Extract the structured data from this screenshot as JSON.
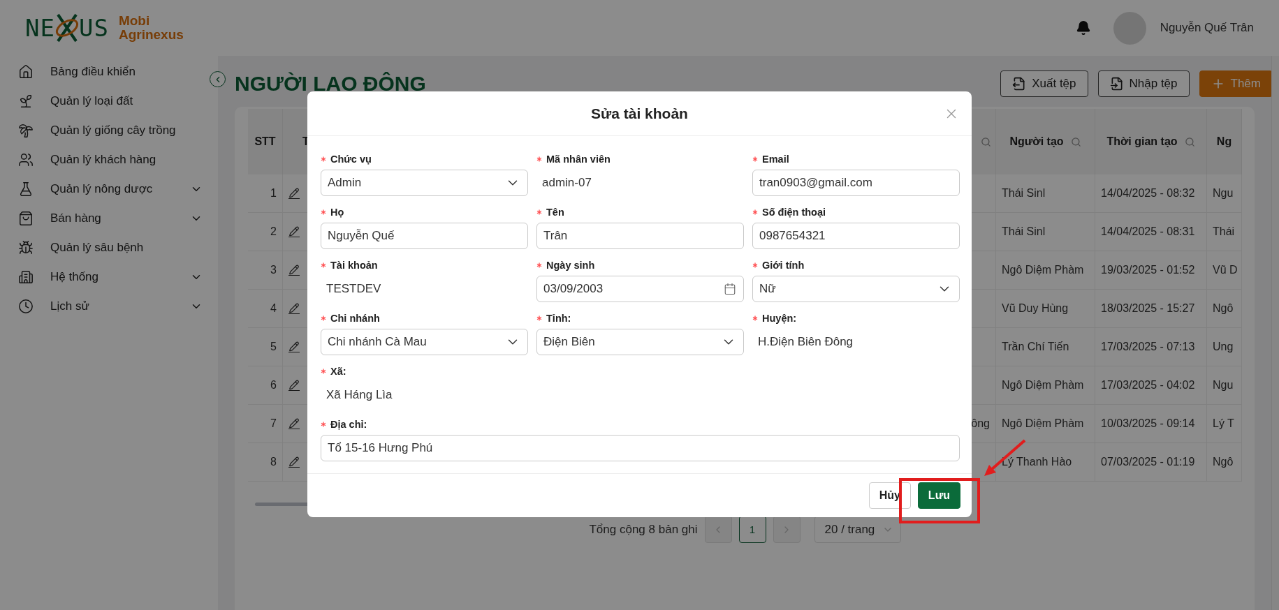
{
  "header": {
    "logo": {
      "left": "NE",
      "right": "US",
      "name_line_1": "Mobi",
      "name_line_2": "Agrinexus"
    },
    "user_name": "Nguyễn Quế Trân"
  },
  "sidebar": {
    "items": [
      {
        "label": "Bảng điều khiển",
        "expandable": false
      },
      {
        "label": "Quản lý loại đất",
        "expandable": false
      },
      {
        "label": "Quản lý giống cây trồng",
        "expandable": false
      },
      {
        "label": "Quản lý khách hàng",
        "expandable": false
      },
      {
        "label": "Quản lý nông dược",
        "expandable": true
      },
      {
        "label": "Bán hàng",
        "expandable": true
      },
      {
        "label": "Quản lý sâu bệnh",
        "expandable": false
      },
      {
        "label": "Hệ thống",
        "expandable": true
      },
      {
        "label": "Lịch sử",
        "expandable": true
      }
    ]
  },
  "page": {
    "title": "NGƯỜI LAO ĐỘNG",
    "actions": [
      {
        "label": "Xuất tệp",
        "kind": "export"
      },
      {
        "label": "Nhập tệp",
        "kind": "import"
      },
      {
        "label": "Thêm",
        "kind": "add"
      }
    ]
  },
  "table": {
    "columns": [
      {
        "label": "STT"
      },
      {
        "label": "T"
      },
      {
        "searchable": true
      },
      {
        "label": "Người tạo",
        "searchable": true
      },
      {
        "label": "Thời gian tạo",
        "searchable": true
      },
      {
        "label": "Ng"
      }
    ],
    "rows": [
      {
        "stt": "1",
        "nguoi_tao": "Thái Sinl",
        "thoi_gian_tao": "14/04/2025 - 08:32",
        "column_6": "Ngu"
      },
      {
        "stt": "2",
        "nguoi_tao": "Thái Sinl",
        "thoi_gian_tao": "14/04/2025 - 08:31",
        "column_6": "Thái"
      },
      {
        "stt": "3",
        "nguoi_tao": "Ngô Diệm Phàm",
        "thoi_gian_tao": "19/03/2025 - 01:52",
        "column_6": "Vũ D"
      },
      {
        "stt": "4",
        "nguoi_tao": "Vũ Duy Hùng",
        "thoi_gian_tao": "18/03/2025 - 15:27",
        "column_6": "Ngô"
      },
      {
        "stt": "5",
        "nguoi_tao": "Trần Chí Tiến",
        "thoi_gian_tao": "17/03/2025 - 07:13",
        "column_6": "Ung"
      },
      {
        "stt": "6",
        "nguoi_tao": "Ngô Diệm Phàm",
        "thoi_gian_tao": "17/03/2025 - 04:02",
        "column_6": "Ngu"
      },
      {
        "stt": "7",
        "column_3": "ông",
        "nguoi_tao": "Ngô Diệm Phàm",
        "thoi_gian_tao": "10/03/2025 - 09:14",
        "column_6": "Lý T"
      },
      {
        "stt": "8",
        "nguoi_tao": "Lý Thanh Hào",
        "thoi_gian_tao": "07/03/2025 - 01:19",
        "column_6": "Ngô"
      }
    ]
  },
  "pagination": {
    "total": "Tổng cộng 8 bản ghi",
    "pages": [
      {
        "label": "1",
        "selected": true
      }
    ],
    "page_size": "20 / trang"
  },
  "modal": {
    "title": "Sửa tài khoản",
    "fields": [
      {
        "label": "Chức vụ",
        "required": true,
        "kind": "select",
        "value": "Admin"
      },
      {
        "label": "Mã nhân viên",
        "required": true,
        "kind": "text",
        "value": "admin-07"
      },
      {
        "label": "Email",
        "required": true,
        "kind": "input",
        "value": "tran0903@gmail.com"
      },
      {
        "label": "Họ",
        "required": true,
        "kind": "input",
        "value": "Nguyễn Quế"
      },
      {
        "label": "Tên",
        "required": true,
        "kind": "input",
        "value": "Trân"
      },
      {
        "label": "Số điện thoại",
        "required": true,
        "kind": "input",
        "value": "0987654321"
      },
      {
        "label": "Tài khoản",
        "required": true,
        "kind": "text",
        "value": "TESTDEV"
      },
      {
        "label": "Ngày sinh",
        "required": true,
        "kind": "date",
        "value": "03/09/2003"
      },
      {
        "label": "Giới tính",
        "required": true,
        "kind": "select",
        "value": "Nữ"
      },
      {
        "label": "Chi nhánh",
        "required": true,
        "kind": "select",
        "value": "Chi nhánh Cà Mau"
      },
      {
        "label": "Tỉnh:",
        "required": true,
        "kind": "select",
        "value": "Điện Biên"
      },
      {
        "label": "Huyện:",
        "required": true,
        "kind": "text",
        "value": "H.Điện Biên Đông"
      },
      {
        "label": "Xã:",
        "required": true,
        "kind": "text",
        "value": "Xã Háng Lìa"
      },
      {
        "label": "Địa chỉ:",
        "required": true,
        "kind": "input",
        "value": "Tổ 15-16 Hưng Phú",
        "full_width": true
      }
    ],
    "buttons": [
      {
        "label": "Hủy",
        "kind": "secondary"
      },
      {
        "label": "Lưu",
        "kind": "primary"
      }
    ]
  }
}
